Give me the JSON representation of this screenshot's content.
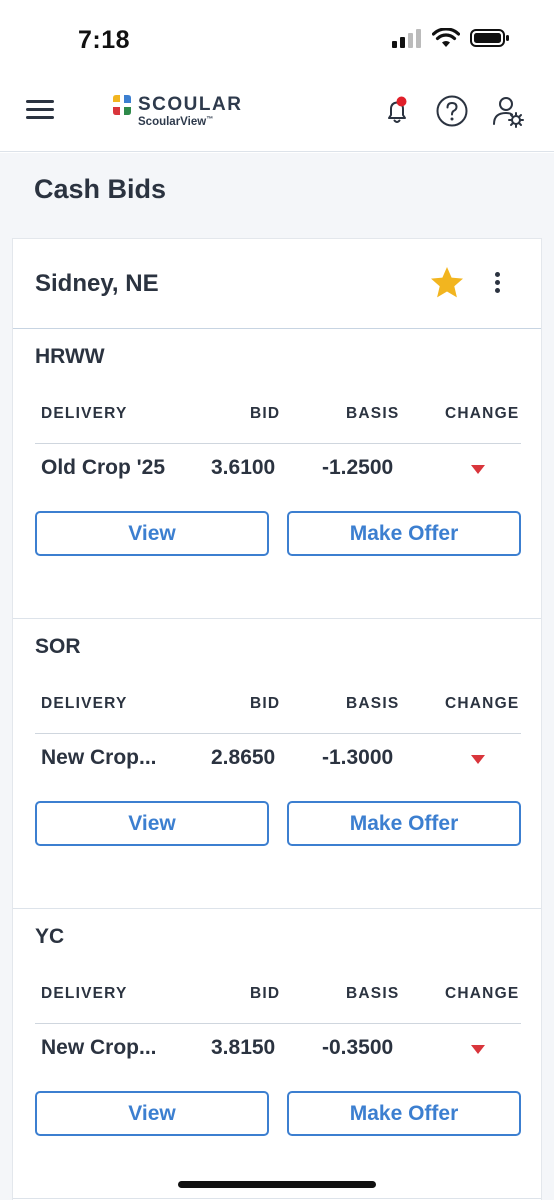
{
  "status_bar": {
    "time": "7:18"
  },
  "header": {
    "logo_name": "SCOULAR",
    "logo_sub": "ScoularView",
    "logo_sub_mark": "™"
  },
  "page": {
    "title": "Cash Bids"
  },
  "location": {
    "name": "Sidney, NE",
    "favorite": true,
    "commodities": [
      {
        "name": "HRWW",
        "columns": [
          "DELIVERY",
          "BID",
          "BASIS",
          "CHANGE"
        ],
        "row": {
          "delivery": "Old Crop '25",
          "bid": "3.6100",
          "basis": "-1.2500",
          "change": "down"
        },
        "view_label": "View",
        "offer_label": "Make Offer"
      },
      {
        "name": "SOR",
        "columns": [
          "DELIVERY",
          "BID",
          "BASIS",
          "CHANGE"
        ],
        "row": {
          "delivery": "New Crop...",
          "bid": "2.8650",
          "basis": "-1.3000",
          "change": "down"
        },
        "view_label": "View",
        "offer_label": "Make Offer"
      },
      {
        "name": "YC",
        "columns": [
          "DELIVERY",
          "BID",
          "BASIS",
          "CHANGE"
        ],
        "row": {
          "delivery": "New Crop...",
          "bid": "3.8150",
          "basis": "-0.3500",
          "change": "down"
        },
        "view_label": "View",
        "offer_label": "Make Offer"
      }
    ]
  },
  "icons": {
    "menu": "hamburger-menu-icon",
    "notifications": "bell-icon",
    "help": "help-circle-icon",
    "account": "user-settings-icon",
    "favorite": "star-icon",
    "more": "more-vertical-icon",
    "change_down": "triangle-down-icon"
  },
  "colors": {
    "accent": "#3c7fd0",
    "star": "#f2b51f",
    "down": "#d9353b",
    "notification_dot": "#e0202a",
    "text": "#2b3340"
  }
}
